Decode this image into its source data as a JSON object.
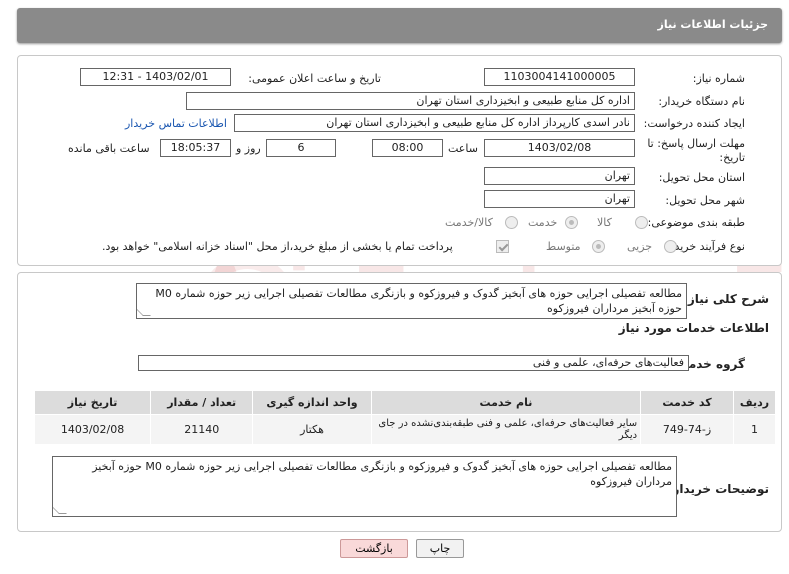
{
  "header": {
    "title": "جزئیات اطلاعات نیاز"
  },
  "form": {
    "need_number_label": "شماره نیاز:",
    "need_number": "1103004141000005",
    "announce_label": "تاریخ و ساعت اعلان عمومی:",
    "announce_value": "1403/02/01 - 12:31",
    "buyer_org_label": "نام دستگاه خریدار:",
    "buyer_org": "اداره کل منابع طبیعی و ابخیزداری استان تهران",
    "creator_label": "ایجاد کننده درخواست:",
    "creator": "نادر اسدی کارپرداز اداره کل منابع طبیعی و ابخیزداری استان تهران",
    "contact_link": "اطلاعات تماس خریدار",
    "deadline_label_1": "مهلت ارسال پاسخ: تا",
    "deadline_label_2": "تاریخ:",
    "deadline_date": "1403/02/08",
    "time_label": "ساعت",
    "deadline_time": "08:00",
    "days_value": "6",
    "days_label": "روز و",
    "remaining_time": "18:05:37",
    "remaining_label": "ساعت باقی مانده",
    "province_label": "استان محل تحویل:",
    "province": "تهران",
    "city_label": "شهر محل تحویل:",
    "city": "تهران",
    "category_label": "طبقه بندی موضوعی:",
    "category_options": [
      "کالا",
      "خدمت",
      "کالا/خدمت"
    ],
    "category_selected": "خدمت",
    "process_label": "نوع فرآیند خرید :",
    "process_options": [
      "جزیی",
      "متوسط"
    ],
    "process_selected": "متوسط",
    "payment_note": "پرداخت تمام یا بخشی از مبلغ خرید،از محل \"اسناد خزانه اسلامی\" خواهد بود."
  },
  "summary": {
    "label": "شرح کلی نیاز:",
    "text": "مطالعه تفصیلی اجرایی حوزه های آبخیز گدوک و فیروزکوه و بازنگری مطالعات تفصیلی اجرایی زیر حوزه شماره M0 حوزه آبخیز مرداران فیروزکوه"
  },
  "services": {
    "title": "اطلاعات خدمات مورد نیاز",
    "group_label": "گروه خدمت:",
    "group_value": "فعالیت‌های حرفه‌ای، علمی و فنی",
    "columns": [
      "ردیف",
      "کد خدمت",
      "نام خدمت",
      "واحد اندازه گیری",
      "تعداد / مقدار",
      "تاریخ نیاز"
    ],
    "rows": [
      {
        "row": "1",
        "code": "ز-74-749",
        "name": "سایر فعالیت‌های حرفه‌ای، علمی و فنی طبقه‌بندی‌نشده در جای دیگر",
        "unit": "هکتار",
        "qty": "21140",
        "date": "1403/02/08"
      }
    ]
  },
  "buyer_notes": {
    "label": "توضیحات خریدار:",
    "text": "مطالعه تفصیلی اجرایی حوزه های آبخیز گدوک و فیروزکوه و بازنگری مطالعات تفصیلی اجرایی زیر حوزه شماره M0 حوزه آبخیز مرداران فیروزکوه"
  },
  "buttons": {
    "print": "چاپ",
    "back": "بازگشت"
  },
  "watermark": "AriaTender.neT",
  "colors": {
    "header": "#8a8a8a",
    "link": "#1a56b0",
    "back_button": "#f9d9d9"
  }
}
